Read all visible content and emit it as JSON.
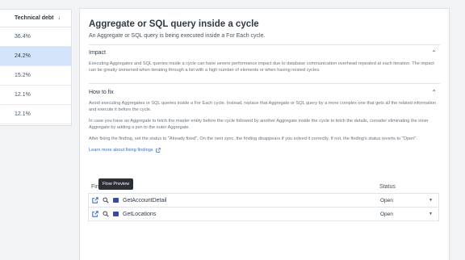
{
  "debt_table": {
    "header": "Technical debt",
    "sort_icon": "arrow-down-icon",
    "rows": [
      "36.4%",
      "24.2%",
      "15.2%",
      "12.1%",
      "12.1%"
    ]
  },
  "detail": {
    "title": "Aggregate or SQL query inside a cycle",
    "subtitle": "An Aggregate or SQL query is being executed inside a For Each cycle.",
    "impact": {
      "heading": "Impact",
      "text": "Executing Aggregates and SQL queries inside a cycle can have severe performance impact due to database communication overhead repeated at each iteration. The impact can be greatly worsened when iterating through a list with a high number of elements or when having nested cycles."
    },
    "how_to_fix": {
      "heading": "How to fix",
      "p1": "Avoid executing Aggregates or SQL queries inside a For Each cycle. Instead, replace that Aggregate or SQL query by a more complex one that gets all the related information and execute it before the cycle.",
      "p2": "In case you have an Aggregate to fetch the master entity before the cycle followed by another Aggregate inside the cycle to fetch the details, consider eliminating the inner Aggregate by adding a join to the outer Aggregate.",
      "p3": "After fixing the finding, set the status to \"Already fixed\". On the next sync, the finding disappears if you solved it correctly. If not, the finding's status reverts to \"Open\".",
      "link": "Learn more about fixing findings"
    }
  },
  "findings": {
    "col_name": "Fin",
    "col_status": "Status",
    "tooltip": "Flow Preview",
    "rows": [
      {
        "name": "GetAccountDetail",
        "status": "Open"
      },
      {
        "name": "GetLocations",
        "status": "Open"
      }
    ]
  }
}
